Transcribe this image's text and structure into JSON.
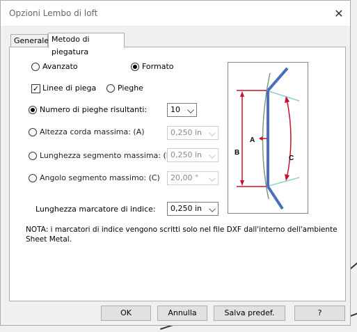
{
  "window": {
    "title": "Opzioni Lembo di loft",
    "close": "✕"
  },
  "tabs": [
    {
      "label": "Generale"
    },
    {
      "label": "Metodo di piegatura"
    }
  ],
  "method": {
    "advanced_label": "Avanzato",
    "formed_label": "Formato",
    "bend_lines_label": "Linee di piega",
    "bends_label": "Pieghe"
  },
  "options": {
    "num_bends": {
      "label": "Numero di pieghe risultanti:",
      "value": "10"
    },
    "max_chord_height": {
      "label": "Altezza corda massima: (A)",
      "value": "0,250 in"
    },
    "max_segment_length": {
      "label": "Lunghezza segmento massima: (B)",
      "value": "0,250 in"
    },
    "max_segment_angle": {
      "label": "Angolo segmento massimo: (C)",
      "value": "20,00 °"
    }
  },
  "index_marker": {
    "label": "Lunghezza marcatore di indice:",
    "value": "0,250 in"
  },
  "note": {
    "line1": "NOTA: i marcatori di indice vengono scritti solo nel file DXF dall'interno dell'ambiente",
    "line2": "Sheet Metal."
  },
  "diagram": {
    "label_a": "A",
    "label_b": "B",
    "label_c": "C"
  },
  "buttons": {
    "ok": "OK",
    "cancel": "Annulla",
    "save_default": "Salva predef.",
    "help": "?"
  },
  "colors": {
    "diagram_red": "#c8102e",
    "diagram_blue": "#4a6fbf",
    "diagram_green": "#7a9a7a",
    "diagram_cyan": "#8fd0d8"
  }
}
